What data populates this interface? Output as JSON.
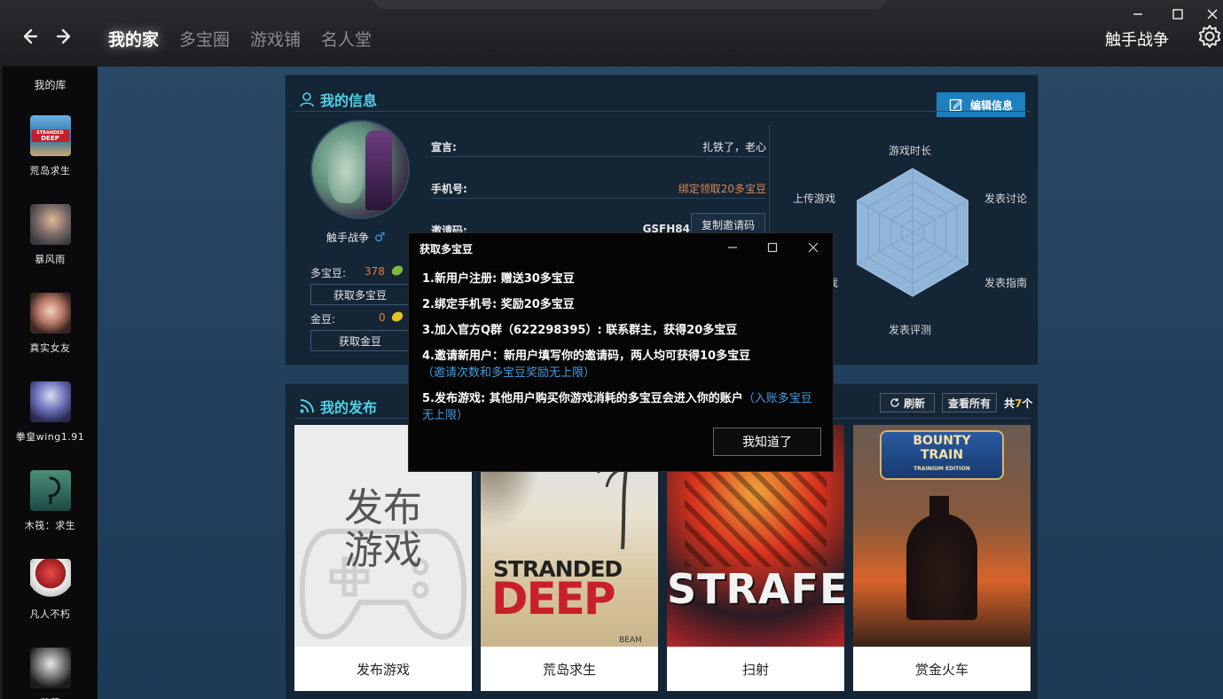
{
  "nav": {
    "tabs": [
      {
        "label": "我的家",
        "active": true
      },
      {
        "label": "多宝圈"
      },
      {
        "label": "游戏铺"
      },
      {
        "label": "名人堂"
      }
    ],
    "username": "触手战争"
  },
  "sidebar": {
    "title": "我的库",
    "items": [
      {
        "label": "荒岛求生",
        "icon": "stranded-deep-icon"
      },
      {
        "label": "暴风雨",
        "icon": "storm-game-icon"
      },
      {
        "label": "真实女友",
        "icon": "real-girlfriend-icon"
      },
      {
        "label": "拳皇wing1.91",
        "icon": "kof-wing-icon"
      },
      {
        "label": "木筏：求生",
        "icon": "raft-icon"
      },
      {
        "label": "凡人不朽",
        "icon": "immortal-icon"
      },
      {
        "label": "苍蓝",
        "icon": "blue-icon"
      }
    ]
  },
  "profile": {
    "title": "我的信息",
    "edit_label": "编辑信息",
    "name": "触手战争",
    "duobao_label": "多宝豆:",
    "duobao_value": "378",
    "get_duobao_label": "获取多宝豆",
    "gold_label": "金豆:",
    "gold_value": "0",
    "get_gold_label": "获取金豆",
    "motto_label": "宣言:",
    "motto_value": "扎铁了，老心",
    "phone_label": "手机号:",
    "phone_value": "绑定领取20多宝豆",
    "invite_label": "邀请码:",
    "invite_value": "GSFH84",
    "copy_label": "复制邀请码"
  },
  "radar": {
    "labels": [
      "游戏时长",
      "发表讨论",
      "发表指南",
      "发表评测",
      "游戏",
      "上传游戏"
    ],
    "values": [
      1,
      1,
      1,
      1,
      1,
      1
    ]
  },
  "publish": {
    "title": "我的发布",
    "refresh_label": "刷新",
    "view_all_label": "查看所有",
    "total_prefix": "共",
    "total_count": "7",
    "total_suffix": "个",
    "cards": [
      {
        "name": "发布游戏",
        "art_text": "发布\n游戏"
      },
      {
        "name": "荒岛求生",
        "art_text_1": "STRANDED",
        "art_text_2": "DEEP",
        "art_text_3": "BEAM"
      },
      {
        "name": "扫射",
        "art_text": "STRAFE"
      },
      {
        "name": "赏金火车",
        "art_text_1": "BOUNTY",
        "art_text_2": "TRAIN",
        "art_text_3": "TRAINIUM EDITION"
      }
    ]
  },
  "modal": {
    "title": "获取多宝豆",
    "line1": "1.新用户注册: 赠送30多宝豆",
    "line2": "2.绑定手机号: 奖励20多宝豆",
    "line3": "3.加入官方Q群（622298395）: 联系群主，获得20多宝豆",
    "line4": "4.邀请新用户：新用户填写你的邀请码，两人均可获得10多宝豆",
    "line4_hint": "（邀请次数和多宝豆奖励无上限）",
    "line5": "5.发布游戏: 其他用户购买你游戏消耗的多宝豆会进入你的账户",
    "line5_hint": "（入账多宝豆无上限）",
    "ok_label": "我知道了"
  },
  "colors": {
    "accent": "#4fd1e6",
    "edit_button": "#1e7fbf",
    "coin_value": "#e0803a",
    "hint_blue": "#3f9be0"
  }
}
